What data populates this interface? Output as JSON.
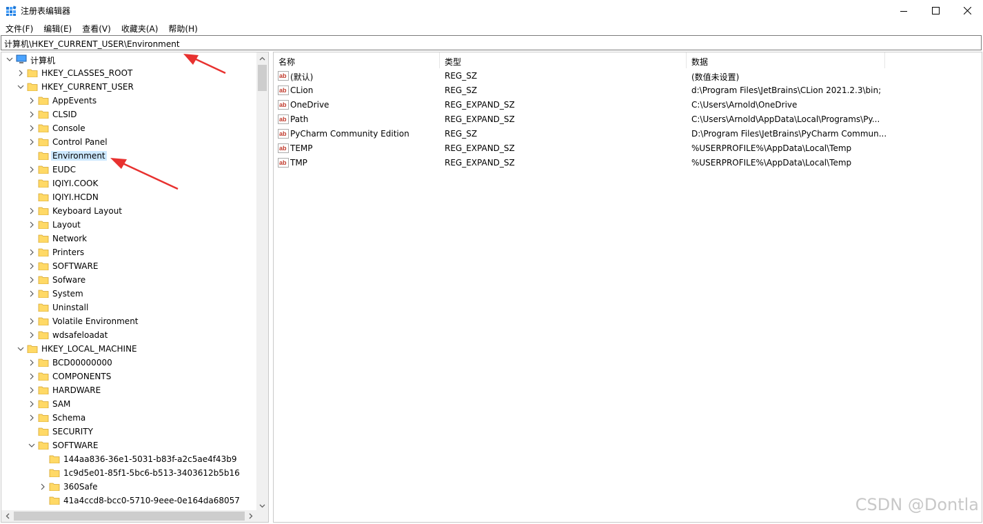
{
  "window": {
    "title": "注册表编辑器"
  },
  "menu": [
    "文件(F)",
    "编辑(E)",
    "查看(V)",
    "收藏夹(A)",
    "帮助(H)"
  ],
  "address": "计算机\\HKEY_CURRENT_USER\\Environment",
  "tree": [
    {
      "label": "计算机",
      "level": 0,
      "state": "expanded",
      "icon": "computer-icon"
    },
    {
      "label": "HKEY_CLASSES_ROOT",
      "level": 1,
      "state": "collapsed"
    },
    {
      "label": "HKEY_CURRENT_USER",
      "level": 1,
      "state": "expanded"
    },
    {
      "label": "AppEvents",
      "level": 2,
      "state": "collapsed"
    },
    {
      "label": "CLSID",
      "level": 2,
      "state": "collapsed"
    },
    {
      "label": "Console",
      "level": 2,
      "state": "collapsed"
    },
    {
      "label": "Control Panel",
      "level": 2,
      "state": "collapsed"
    },
    {
      "label": "Environment",
      "level": 2,
      "state": "leaf",
      "selected": true
    },
    {
      "label": "EUDC",
      "level": 2,
      "state": "collapsed"
    },
    {
      "label": "IQIYI.COOK",
      "level": 2,
      "state": "leaf"
    },
    {
      "label": "IQIYI.HCDN",
      "level": 2,
      "state": "leaf"
    },
    {
      "label": "Keyboard Layout",
      "level": 2,
      "state": "collapsed"
    },
    {
      "label": "Layout",
      "level": 2,
      "state": "collapsed"
    },
    {
      "label": "Network",
      "level": 2,
      "state": "leaf"
    },
    {
      "label": "Printers",
      "level": 2,
      "state": "collapsed"
    },
    {
      "label": "SOFTWARE",
      "level": 2,
      "state": "collapsed"
    },
    {
      "label": "Sofware",
      "level": 2,
      "state": "collapsed"
    },
    {
      "label": "System",
      "level": 2,
      "state": "collapsed"
    },
    {
      "label": "Uninstall",
      "level": 2,
      "state": "leaf"
    },
    {
      "label": "Volatile Environment",
      "level": 2,
      "state": "collapsed"
    },
    {
      "label": "wdsafeloadat",
      "level": 2,
      "state": "collapsed"
    },
    {
      "label": "HKEY_LOCAL_MACHINE",
      "level": 1,
      "state": "expanded"
    },
    {
      "label": "BCD00000000",
      "level": 2,
      "state": "collapsed"
    },
    {
      "label": "COMPONENTS",
      "level": 2,
      "state": "collapsed"
    },
    {
      "label": "HARDWARE",
      "level": 2,
      "state": "collapsed"
    },
    {
      "label": "SAM",
      "level": 2,
      "state": "collapsed"
    },
    {
      "label": "Schema",
      "level": 2,
      "state": "collapsed"
    },
    {
      "label": "SECURITY",
      "level": 2,
      "state": "leaf"
    },
    {
      "label": "SOFTWARE",
      "level": 2,
      "state": "expanded"
    },
    {
      "label": "144aa836-36e1-5031-b83f-a2c5ae4f43b9",
      "level": 3,
      "state": "leaf"
    },
    {
      "label": "1c9d5e01-85f1-5bc6-b513-3403612b5b16",
      "level": 3,
      "state": "leaf"
    },
    {
      "label": "360Safe",
      "level": 3,
      "state": "collapsed"
    },
    {
      "label": "41a4ccd8-bcc0-5710-9eee-0e164da68057",
      "level": 3,
      "state": "leaf"
    }
  ],
  "list": {
    "columns": [
      "名称",
      "类型",
      "数据"
    ],
    "rows": [
      {
        "name": "(默认)",
        "type": "REG_SZ",
        "data": "(数值未设置)"
      },
      {
        "name": "CLion",
        "type": "REG_SZ",
        "data": "d:\\Program Files\\JetBrains\\CLion 2021.2.3\\bin;"
      },
      {
        "name": "OneDrive",
        "type": "REG_EXPAND_SZ",
        "data": "C:\\Users\\Arnold\\OneDrive"
      },
      {
        "name": "Path",
        "type": "REG_EXPAND_SZ",
        "data": "C:\\Users\\Arnold\\AppData\\Local\\Programs\\Py..."
      },
      {
        "name": "PyCharm Community Edition",
        "type": "REG_SZ",
        "data": "D:\\Program Files\\JetBrains\\PyCharm Commun..."
      },
      {
        "name": "TEMP",
        "type": "REG_EXPAND_SZ",
        "data": "%USERPROFILE%\\AppData\\Local\\Temp"
      },
      {
        "name": "TMP",
        "type": "REG_EXPAND_SZ",
        "data": "%USERPROFILE%\\AppData\\Local\\Temp"
      }
    ]
  },
  "watermark": "CSDN @Dontla",
  "colors": {
    "selection": "#cce8ff",
    "folder": "#ffd966",
    "annotation_arrow": "#e8312f"
  }
}
